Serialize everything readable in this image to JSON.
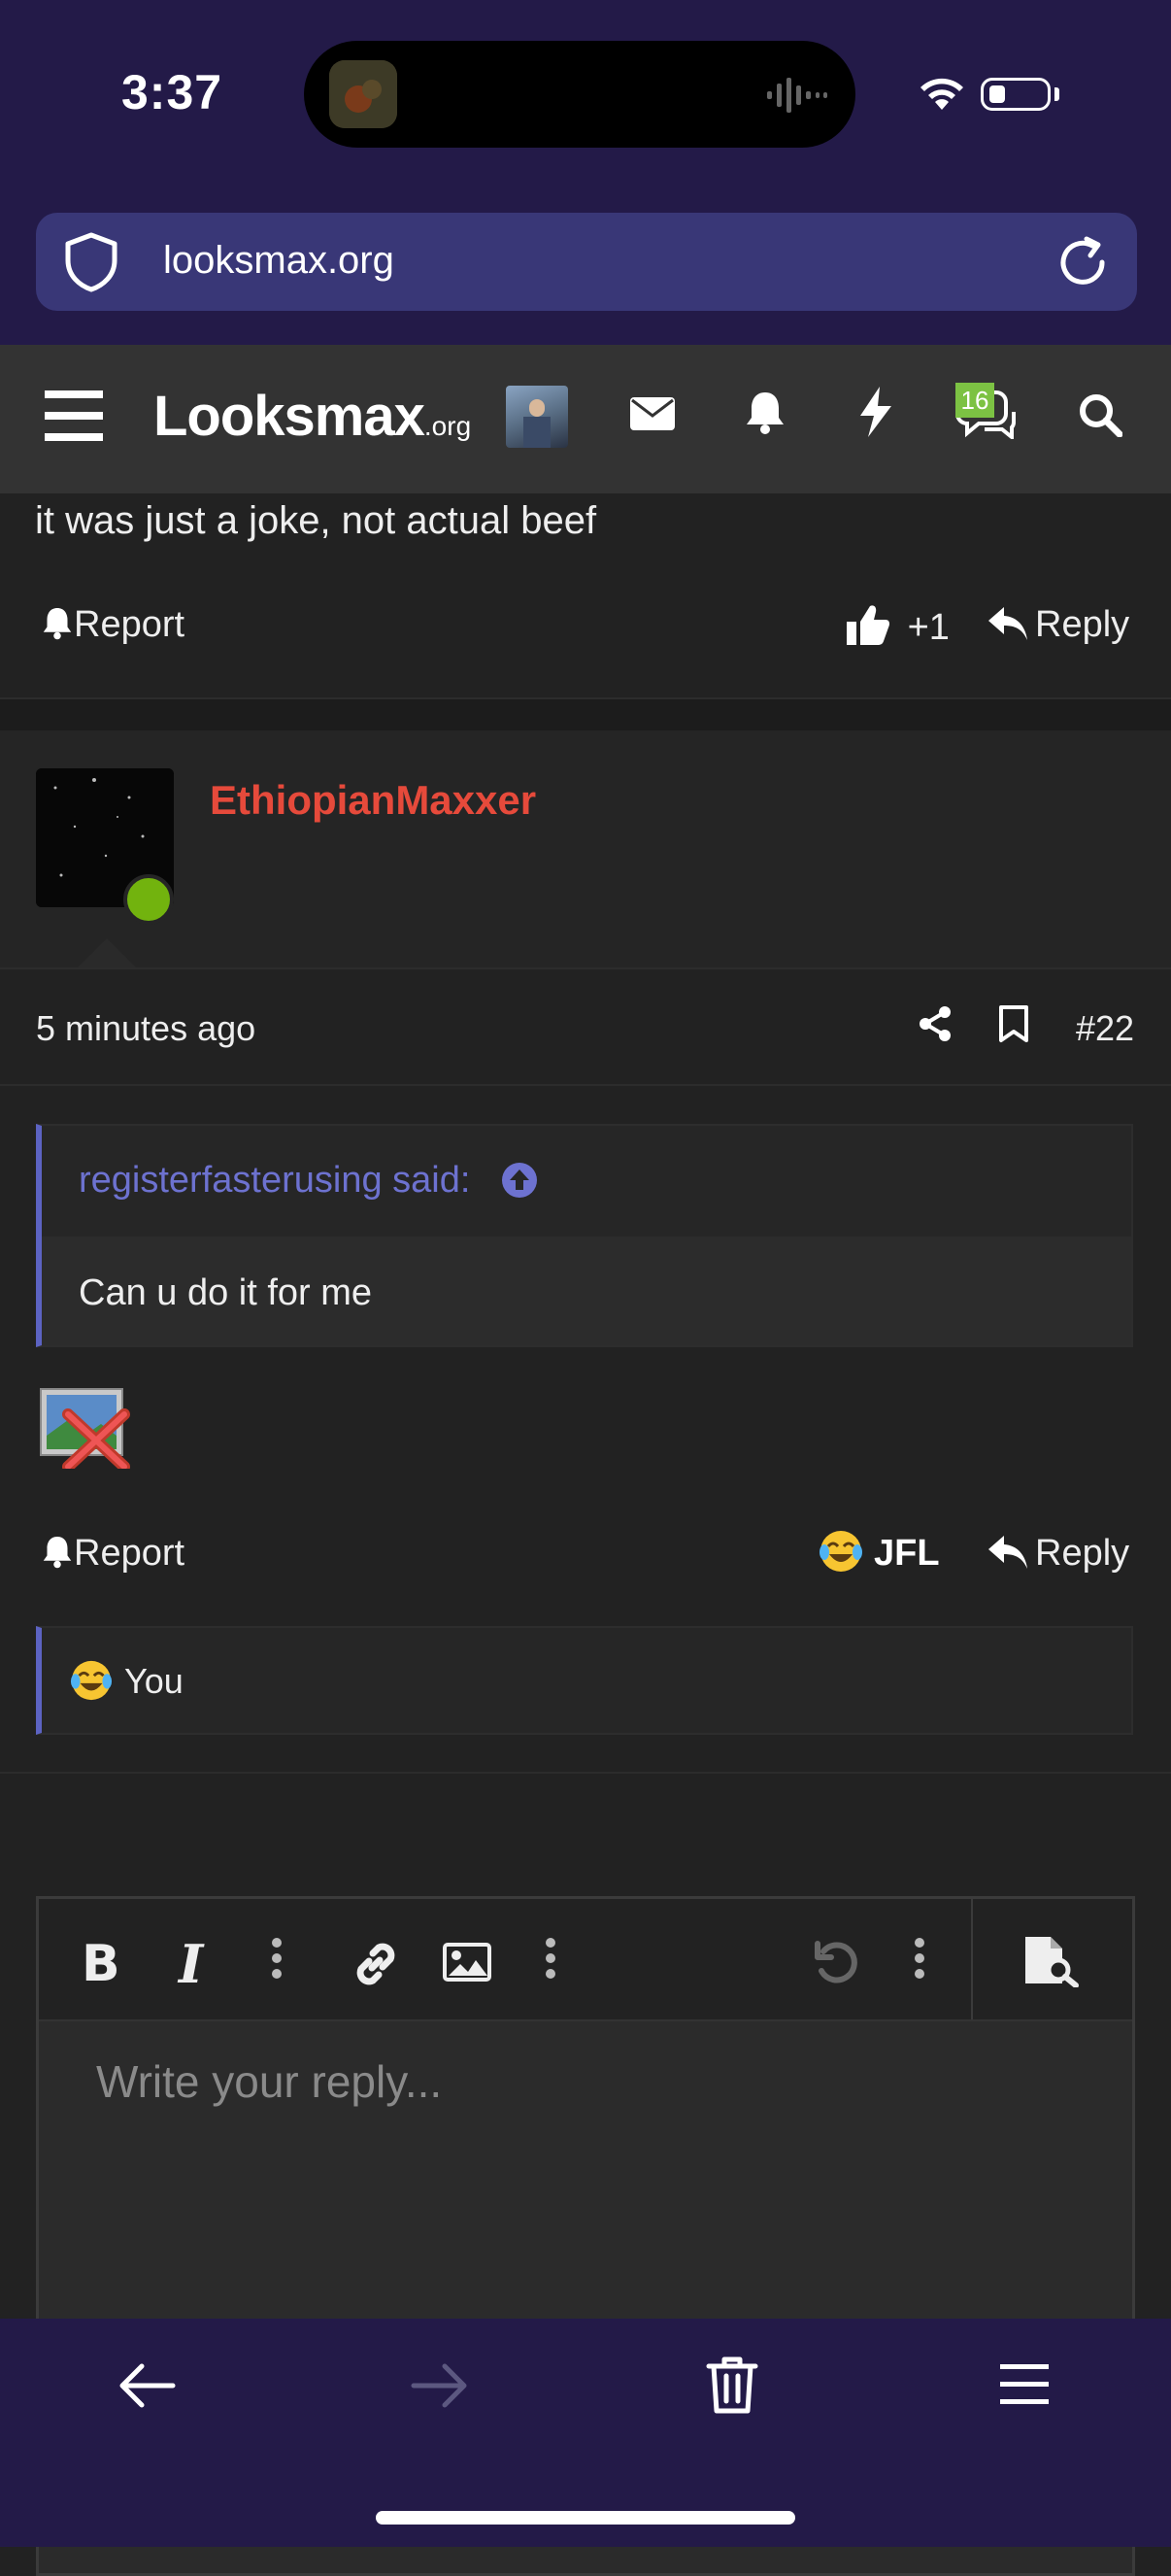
{
  "status": {
    "time": "3:37"
  },
  "browser": {
    "url": "looksmax.org"
  },
  "site": {
    "logo_main": "Looksmax",
    "logo_suffix": ".org",
    "chat_badge": "16"
  },
  "previous_post": {
    "text": "it was just a joke, not actual beef",
    "report_label": "Report",
    "like_count": "+1",
    "reply_label": "Reply"
  },
  "post": {
    "username": "EthiopianMaxxer",
    "username_color": "#e64a3b",
    "timestamp": "5 minutes ago",
    "number": "#22",
    "quote": {
      "author": "registerfasterusing said:",
      "text": "Can u do it for me"
    },
    "report_label": "Report",
    "reaction_label": "JFL",
    "reply_label": "Reply",
    "reaction_summary": "You"
  },
  "editor": {
    "placeholder": "Write your reply..."
  },
  "colors": {
    "accent": "#5c63c2",
    "online": "#72b30e",
    "browser_chrome": "#231a48"
  }
}
